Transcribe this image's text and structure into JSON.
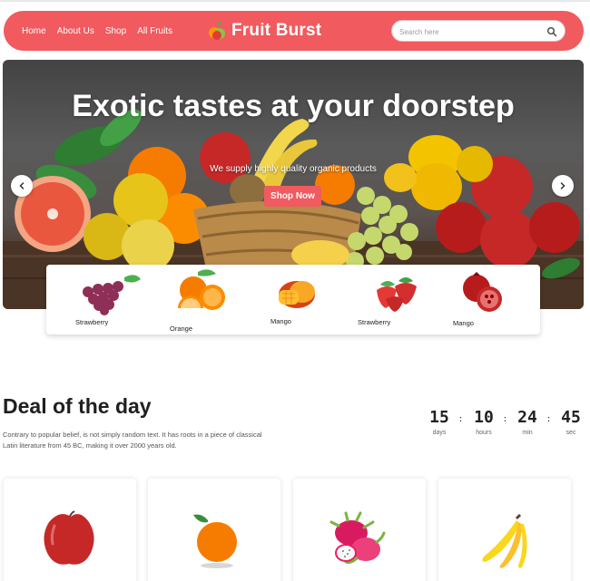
{
  "nav": {
    "links": [
      "Home",
      "About Us",
      "Shop",
      "All Fruits"
    ],
    "brand": "Fruit Burst",
    "search_placeholder": "Search here"
  },
  "hero": {
    "title": "Exotic tastes at your doorstep",
    "subtitle": "We supply highly quality organic products",
    "button_label": "Shop Now"
  },
  "categories": [
    "Strawberry",
    "Orange",
    "Mango",
    "Strawberry",
    "Mango"
  ],
  "deal": {
    "title": "Deal of the day",
    "text": "Contrary to popular belief, is not simply random text. It has roots in a piece of classical Latin literature from 45 BC, making it over 2000 years old.",
    "countdown": [
      {
        "value": "15",
        "label": "days"
      },
      {
        "value": "10",
        "label": "hours"
      },
      {
        "value": "24",
        "label": "min"
      },
      {
        "value": "45",
        "label": "sec"
      }
    ]
  },
  "products": [
    {
      "icon": "apple-icon"
    },
    {
      "icon": "orange-icon"
    },
    {
      "icon": "dragon-fruit-icon"
    },
    {
      "icon": "banana-icon"
    }
  ],
  "colors": {
    "accent": "#f15a5e",
    "text_dark": "#1f1f1f",
    "muted": "#555555"
  }
}
